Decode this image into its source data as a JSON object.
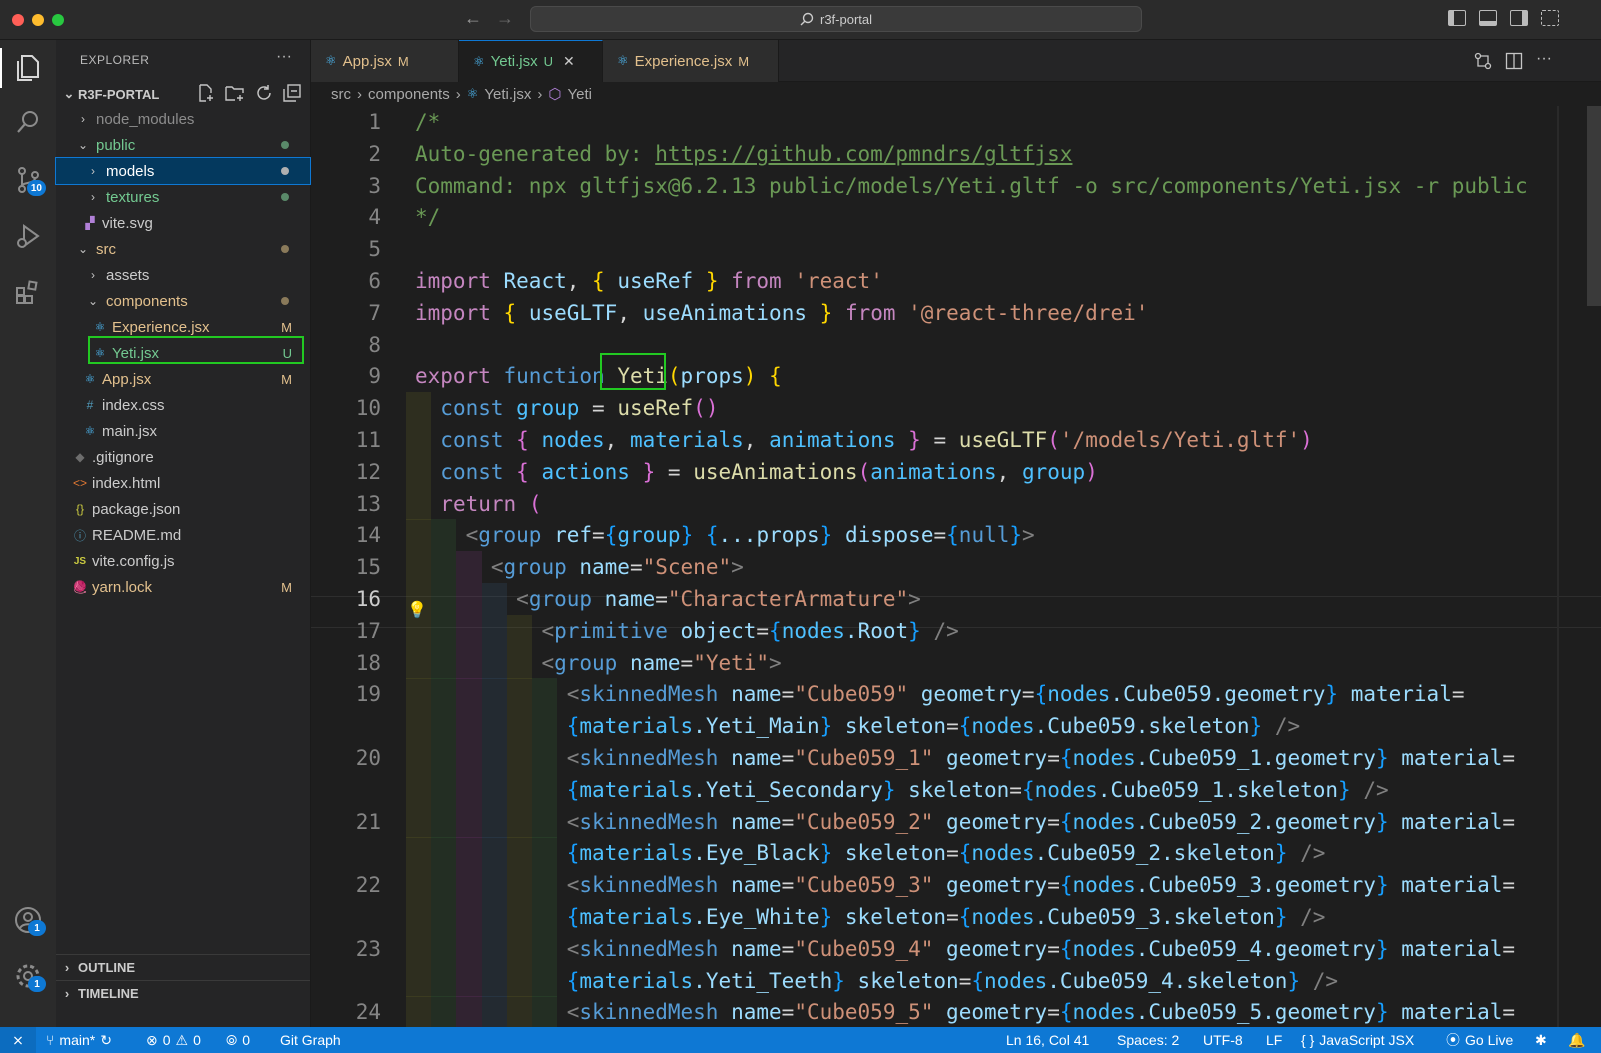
{
  "window": {
    "search_text": "r3f-portal"
  },
  "activity_bar": {
    "source_control_badge": "10",
    "accounts_badge": "1",
    "manage_badge": "1"
  },
  "sidebar": {
    "title": "EXPLORER",
    "more": "···",
    "project": "R3F-PORTAL",
    "items": [
      {
        "label": "node_modules",
        "status": ""
      },
      {
        "label": "public",
        "status": ""
      },
      {
        "label": "models",
        "status": ""
      },
      {
        "label": "textures",
        "status": ""
      },
      {
        "label": "vite.svg",
        "status": ""
      },
      {
        "label": "src",
        "status": ""
      },
      {
        "label": "assets",
        "status": ""
      },
      {
        "label": "components",
        "status": ""
      },
      {
        "label": "Experience.jsx",
        "status": "M"
      },
      {
        "label": "Yeti.jsx",
        "status": "U"
      },
      {
        "label": "App.jsx",
        "status": "M"
      },
      {
        "label": "index.css",
        "status": ""
      },
      {
        "label": "main.jsx",
        "status": ""
      },
      {
        "label": ".gitignore",
        "status": ""
      },
      {
        "label": "index.html",
        "status": ""
      },
      {
        "label": "package.json",
        "status": ""
      },
      {
        "label": "README.md",
        "status": ""
      },
      {
        "label": "vite.config.js",
        "status": ""
      },
      {
        "label": "yarn.lock",
        "status": "M"
      }
    ],
    "outline": "OUTLINE",
    "timeline": "TIMELINE"
  },
  "tabs": [
    {
      "label": "App.jsx",
      "status": "M"
    },
    {
      "label": "Yeti.jsx",
      "status": "U",
      "close": "✕"
    },
    {
      "label": "Experience.jsx",
      "status": "M"
    }
  ],
  "breadcrumb": {
    "p1": "src",
    "p2": "components",
    "p3": "Yeti.jsx",
    "p4": "Yeti"
  },
  "editor": {
    "line_numbers": [
      "1",
      "2",
      "3",
      "4",
      "5",
      "6",
      "7",
      "8",
      "9",
      "10",
      "11",
      "12",
      "13",
      "14",
      "15",
      "16",
      "17",
      "18",
      "19",
      "",
      "20",
      "",
      "21",
      "",
      "22",
      "",
      "23",
      "",
      "24"
    ],
    "lines": [
      [
        [
          "/*",
          "c"
        ]
      ],
      [
        [
          "Auto-generated by: ",
          "c"
        ],
        [
          "https://github.com/pmndrs/gltfjsx",
          "cu"
        ]
      ],
      [
        [
          "Command: npx gltfjsx@6.2.13 public/models/Yeti.gltf -o src/components/Yeti.jsx -r public",
          "c"
        ]
      ],
      [
        [
          "*/",
          "c"
        ]
      ],
      [],
      [
        [
          "import ",
          "k"
        ],
        [
          "React",
          "v"
        ],
        [
          ", ",
          "p"
        ],
        [
          "{ ",
          "b"
        ],
        [
          "useRef",
          "v"
        ],
        [
          " }",
          "b"
        ],
        [
          " from ",
          "k"
        ],
        [
          "'react'",
          "s"
        ]
      ],
      [
        [
          "import ",
          "k"
        ],
        [
          "{ ",
          "b"
        ],
        [
          "useGLTF",
          "v"
        ],
        [
          ", ",
          "p"
        ],
        [
          "useAnimations",
          "v"
        ],
        [
          " }",
          "b"
        ],
        [
          " from ",
          "k"
        ],
        [
          "'@react-three/drei'",
          "s"
        ]
      ],
      [],
      [
        [
          "export ",
          "k"
        ],
        [
          "function ",
          "f"
        ],
        [
          "Yeti",
          "fn"
        ],
        [
          "(",
          "b"
        ],
        [
          "props",
          "v"
        ],
        [
          ") ",
          "b"
        ],
        [
          "{",
          "b"
        ]
      ],
      [
        [
          "  "
        ],
        [
          "const ",
          "f"
        ],
        [
          "group",
          "vv"
        ],
        [
          " = ",
          "p"
        ],
        [
          "useRef",
          "fn"
        ],
        [
          "()",
          "bp"
        ]
      ],
      [
        [
          "  "
        ],
        [
          "const ",
          "f"
        ],
        [
          "{ ",
          "bp"
        ],
        [
          "nodes",
          "vv"
        ],
        [
          ", ",
          "p"
        ],
        [
          "materials",
          "vv"
        ],
        [
          ", ",
          "p"
        ],
        [
          "animations",
          "vv"
        ],
        [
          " }",
          "bp"
        ],
        [
          " = ",
          "p"
        ],
        [
          "useGLTF",
          "fn"
        ],
        [
          "(",
          "bp"
        ],
        [
          "'/models/Yeti.gltf'",
          "s"
        ],
        [
          ")",
          "bp"
        ]
      ],
      [
        [
          "  "
        ],
        [
          "const ",
          "f"
        ],
        [
          "{ ",
          "bp"
        ],
        [
          "actions",
          "vv"
        ],
        [
          " }",
          "bp"
        ],
        [
          " = ",
          "p"
        ],
        [
          "useAnimations",
          "fn"
        ],
        [
          "(",
          "bp"
        ],
        [
          "animations",
          "vv"
        ],
        [
          ", ",
          "p"
        ],
        [
          "group",
          "vv"
        ],
        [
          ")",
          "bp"
        ]
      ],
      [
        [
          "  "
        ],
        [
          "return ",
          "k"
        ],
        [
          "(",
          "bp"
        ]
      ],
      [
        [
          "    "
        ],
        [
          "<",
          "t"
        ],
        [
          "group ",
          "tg"
        ],
        [
          "ref",
          "a"
        ],
        [
          "=",
          "p"
        ],
        [
          "{",
          "bb"
        ],
        [
          "group",
          "vv"
        ],
        [
          "}",
          "bb"
        ],
        [
          " {",
          "bb"
        ],
        [
          "...props",
          "v"
        ],
        [
          "}",
          "bb"
        ],
        [
          " dispose",
          "a"
        ],
        [
          "=",
          "p"
        ],
        [
          "{",
          "bb"
        ],
        [
          "null",
          "f"
        ],
        [
          "}",
          "bb"
        ],
        [
          ">",
          "t"
        ]
      ],
      [
        [
          "      "
        ],
        [
          "<",
          "t"
        ],
        [
          "group ",
          "tg"
        ],
        [
          "name",
          "a"
        ],
        [
          "=",
          "p"
        ],
        [
          "\"Scene\"",
          "s"
        ],
        [
          ">",
          "t"
        ]
      ],
      [
        [
          "        "
        ],
        [
          "<",
          "t"
        ],
        [
          "group ",
          "tg"
        ],
        [
          "name",
          "a"
        ],
        [
          "=",
          "p"
        ],
        [
          "\"CharacterArmature\"",
          "s"
        ],
        [
          ">",
          "t"
        ]
      ],
      [
        [
          "          "
        ],
        [
          "<",
          "t"
        ],
        [
          "primitive ",
          "tg"
        ],
        [
          "object",
          "a"
        ],
        [
          "=",
          "p"
        ],
        [
          "{",
          "bb"
        ],
        [
          "nodes",
          "vv"
        ],
        [
          ".Root",
          "v"
        ],
        [
          "}",
          "bb"
        ],
        [
          " />",
          "t"
        ]
      ],
      [
        [
          "          "
        ],
        [
          "<",
          "t"
        ],
        [
          "group ",
          "tg"
        ],
        [
          "name",
          "a"
        ],
        [
          "=",
          "p"
        ],
        [
          "\"Yeti\"",
          "s"
        ],
        [
          ">",
          "t"
        ]
      ],
      [
        [
          "            "
        ],
        [
          "<",
          "t"
        ],
        [
          "skinnedMesh ",
          "tg"
        ],
        [
          "name",
          "a"
        ],
        [
          "=",
          "p"
        ],
        [
          "\"Cube059\"",
          "s"
        ],
        [
          " geometry",
          "a"
        ],
        [
          "=",
          "p"
        ],
        [
          "{",
          "bb"
        ],
        [
          "nodes",
          "vv"
        ],
        [
          ".Cube059.geometry",
          "v"
        ],
        [
          "}",
          "bb"
        ],
        [
          " material",
          "a"
        ],
        [
          "=",
          "p"
        ]
      ],
      [
        [
          "            "
        ],
        [
          "{",
          "bb"
        ],
        [
          "materials",
          "vv"
        ],
        [
          ".Yeti_Main",
          "v"
        ],
        [
          "}",
          "bb"
        ],
        [
          " skeleton",
          "a"
        ],
        [
          "=",
          "p"
        ],
        [
          "{",
          "bb"
        ],
        [
          "nodes",
          "vv"
        ],
        [
          ".Cube059.skeleton",
          "v"
        ],
        [
          "}",
          "bb"
        ],
        [
          " />",
          "t"
        ]
      ],
      [
        [
          "            "
        ],
        [
          "<",
          "t"
        ],
        [
          "skinnedMesh ",
          "tg"
        ],
        [
          "name",
          "a"
        ],
        [
          "=",
          "p"
        ],
        [
          "\"Cube059_1\"",
          "s"
        ],
        [
          " geometry",
          "a"
        ],
        [
          "=",
          "p"
        ],
        [
          "{",
          "bb"
        ],
        [
          "nodes",
          "vv"
        ],
        [
          ".Cube059_1.geometry",
          "v"
        ],
        [
          "}",
          "bb"
        ],
        [
          " material",
          "a"
        ],
        [
          "=",
          "p"
        ]
      ],
      [
        [
          "            "
        ],
        [
          "{",
          "bb"
        ],
        [
          "materials",
          "vv"
        ],
        [
          ".Yeti_Secondary",
          "v"
        ],
        [
          "}",
          "bb"
        ],
        [
          " skeleton",
          "a"
        ],
        [
          "=",
          "p"
        ],
        [
          "{",
          "bb"
        ],
        [
          "nodes",
          "vv"
        ],
        [
          ".Cube059_1.skeleton",
          "v"
        ],
        [
          "}",
          "bb"
        ],
        [
          " />",
          "t"
        ]
      ],
      [
        [
          "            "
        ],
        [
          "<",
          "t"
        ],
        [
          "skinnedMesh ",
          "tg"
        ],
        [
          "name",
          "a"
        ],
        [
          "=",
          "p"
        ],
        [
          "\"Cube059_2\"",
          "s"
        ],
        [
          " geometry",
          "a"
        ],
        [
          "=",
          "p"
        ],
        [
          "{",
          "bb"
        ],
        [
          "nodes",
          "vv"
        ],
        [
          ".Cube059_2.geometry",
          "v"
        ],
        [
          "}",
          "bb"
        ],
        [
          " material",
          "a"
        ],
        [
          "=",
          "p"
        ]
      ],
      [
        [
          "            "
        ],
        [
          "{",
          "bb"
        ],
        [
          "materials",
          "vv"
        ],
        [
          ".Eye_Black",
          "v"
        ],
        [
          "}",
          "bb"
        ],
        [
          " skeleton",
          "a"
        ],
        [
          "=",
          "p"
        ],
        [
          "{",
          "bb"
        ],
        [
          "nodes",
          "vv"
        ],
        [
          ".Cube059_2.skeleton",
          "v"
        ],
        [
          "}",
          "bb"
        ],
        [
          " />",
          "t"
        ]
      ],
      [
        [
          "            "
        ],
        [
          "<",
          "t"
        ],
        [
          "skinnedMesh ",
          "tg"
        ],
        [
          "name",
          "a"
        ],
        [
          "=",
          "p"
        ],
        [
          "\"Cube059_3\"",
          "s"
        ],
        [
          " geometry",
          "a"
        ],
        [
          "=",
          "p"
        ],
        [
          "{",
          "bb"
        ],
        [
          "nodes",
          "vv"
        ],
        [
          ".Cube059_3.geometry",
          "v"
        ],
        [
          "}",
          "bb"
        ],
        [
          " material",
          "a"
        ],
        [
          "=",
          "p"
        ]
      ],
      [
        [
          "            "
        ],
        [
          "{",
          "bb"
        ],
        [
          "materials",
          "vv"
        ],
        [
          ".Eye_White",
          "v"
        ],
        [
          "}",
          "bb"
        ],
        [
          " skeleton",
          "a"
        ],
        [
          "=",
          "p"
        ],
        [
          "{",
          "bb"
        ],
        [
          "nodes",
          "vv"
        ],
        [
          ".Cube059_3.skeleton",
          "v"
        ],
        [
          "}",
          "bb"
        ],
        [
          " />",
          "t"
        ]
      ],
      [
        [
          "            "
        ],
        [
          "<",
          "t"
        ],
        [
          "skinnedMesh ",
          "tg"
        ],
        [
          "name",
          "a"
        ],
        [
          "=",
          "p"
        ],
        [
          "\"Cube059_4\"",
          "s"
        ],
        [
          " geometry",
          "a"
        ],
        [
          "=",
          "p"
        ],
        [
          "{",
          "bb"
        ],
        [
          "nodes",
          "vv"
        ],
        [
          ".Cube059_4.geometry",
          "v"
        ],
        [
          "}",
          "bb"
        ],
        [
          " material",
          "a"
        ],
        [
          "=",
          "p"
        ]
      ],
      [
        [
          "            "
        ],
        [
          "{",
          "bb"
        ],
        [
          "materials",
          "vv"
        ],
        [
          ".Yeti_Teeth",
          "v"
        ],
        [
          "}",
          "bb"
        ],
        [
          " skeleton",
          "a"
        ],
        [
          "=",
          "p"
        ],
        [
          "{",
          "bb"
        ],
        [
          "nodes",
          "vv"
        ],
        [
          ".Cube059_4.skeleton",
          "v"
        ],
        [
          "}",
          "bb"
        ],
        [
          " />",
          "t"
        ]
      ],
      [
        [
          "            "
        ],
        [
          "<",
          "t"
        ],
        [
          "skinnedMesh ",
          "tg"
        ],
        [
          "name",
          "a"
        ],
        [
          "=",
          "p"
        ],
        [
          "\"Cube059_5\"",
          "s"
        ],
        [
          " geometry",
          "a"
        ],
        [
          "=",
          "p"
        ],
        [
          "{",
          "bb"
        ],
        [
          "nodes",
          "vv"
        ],
        [
          ".Cube059_5.geometry",
          "v"
        ],
        [
          "}",
          "bb"
        ],
        [
          " material",
          "a"
        ],
        [
          "=",
          "p"
        ]
      ]
    ]
  },
  "status_bar": {
    "branch": "main*",
    "errors": "0",
    "warnings": "0",
    "ports": "0",
    "git_graph": "Git Graph",
    "position": "Ln 16, Col 41",
    "spaces": "Spaces: 2",
    "encoding": "UTF-8",
    "eol": "LF",
    "braces": "{ }",
    "language": "JavaScript JSX",
    "go_live": "Go Live"
  },
  "colors": {
    "accent": "#0e78d4",
    "comment": "#6a9955",
    "keyword": "#c586c0",
    "string": "#ce9178",
    "modified": "#e2c08d",
    "untracked": "#73c991",
    "highlight": "#22c922"
  }
}
